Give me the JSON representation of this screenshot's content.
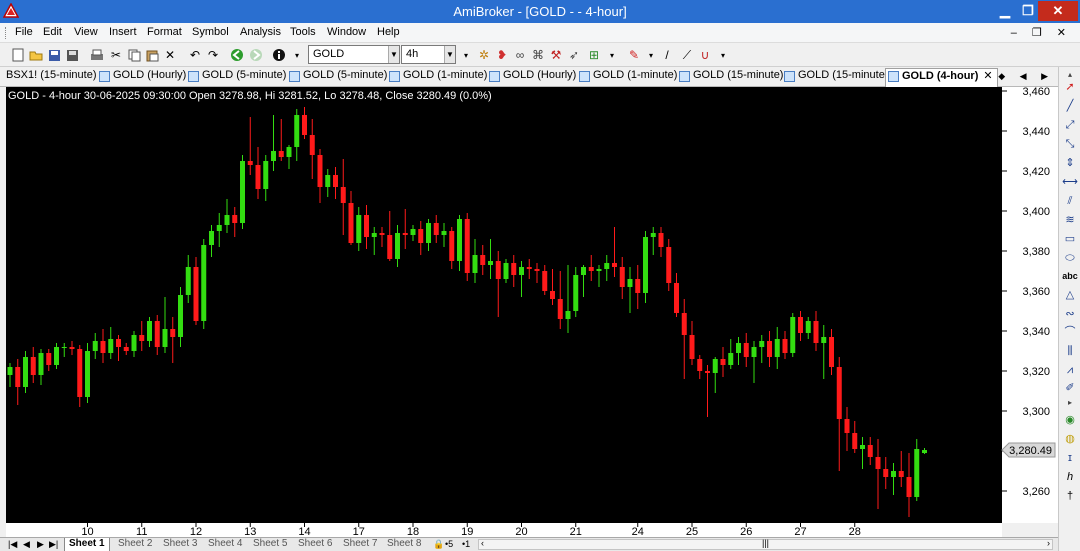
{
  "window": {
    "title": "AmiBroker - [GOLD -  - 4-hour]",
    "minimize": "▁",
    "maximize": "❐",
    "close": "✕"
  },
  "menu": {
    "items": [
      "File",
      "Edit",
      "View",
      "Insert",
      "Format",
      "Symbol",
      "Analysis",
      "Tools",
      "Window",
      "Help"
    ],
    "mdi_controls": "‒ ❐ ✕"
  },
  "toolbar": {
    "symbol_value": "GOLD",
    "interval_value": "4h"
  },
  "tabs": {
    "items": [
      {
        "label": "BSX1! (15-minute)",
        "active": false
      },
      {
        "label": "GOLD (Hourly)",
        "active": false
      },
      {
        "label": "GOLD (5-minute)",
        "active": false
      },
      {
        "label": "GOLD (5-minute)",
        "active": false
      },
      {
        "label": "GOLD (1-minute)",
        "active": false
      },
      {
        "label": "GOLD (Hourly)",
        "active": false
      },
      {
        "label": "GOLD (1-minute)",
        "active": false
      },
      {
        "label": "GOLD (15-minute)",
        "active": false
      },
      {
        "label": "GOLD (15-minute)",
        "active": false
      },
      {
        "label": "GOLD (4-hour)",
        "active": true
      }
    ],
    "close_glyph": "✕",
    "nav": "◆ ◀ ▶"
  },
  "chart": {
    "header": "GOLD - 4-hour 30-06-2025 09:30:00 Open 3278.98, Hi 3281.52, Lo 3278.48, Close 3280.49 (0.0%)",
    "price_label": "3,280.49",
    "colors": {
      "up": "#33dd11",
      "down": "#ff1a1a",
      "background": "#000000",
      "grid": "#222222"
    }
  },
  "chart_data": {
    "type": "candlestick",
    "symbol": "GOLD",
    "interval": "4-hour",
    "ylim": [
      3244,
      3462
    ],
    "yticks": [
      3260,
      3280,
      3300,
      3320,
      3340,
      3360,
      3380,
      3400,
      3420,
      3440,
      3460
    ],
    "ytick_labels": [
      "3,260",
      "3,280",
      "3,300",
      "3,320",
      "3,340",
      "3,360",
      "3,380",
      "3,400",
      "3,420",
      "3,440",
      "3,460"
    ],
    "x_labels": [
      {
        "label": "10",
        "index": 10
      },
      {
        "label": "11",
        "index": 17
      },
      {
        "label": "12",
        "index": 24
      },
      {
        "label": "13",
        "index": 31
      },
      {
        "label": "14",
        "index": 38
      },
      {
        "label": "17",
        "index": 45
      },
      {
        "label": "18",
        "index": 52
      },
      {
        "label": "19",
        "index": 59
      },
      {
        "label": "20",
        "index": 66
      },
      {
        "label": "21",
        "index": 73
      },
      {
        "label": "24",
        "index": 81
      },
      {
        "label": "25",
        "index": 88
      },
      {
        "label": "26",
        "index": 95
      },
      {
        "label": "27",
        "index": 102
      },
      {
        "label": "28",
        "index": 109
      }
    ],
    "candles": [
      [
        3318,
        3324,
        3312,
        3322
      ],
      [
        3322,
        3326,
        3303,
        3312
      ],
      [
        3312,
        3330,
        3309,
        3327
      ],
      [
        3327,
        3332,
        3314,
        3318
      ],
      [
        3318,
        3331,
        3313,
        3329
      ],
      [
        3329,
        3331,
        3320,
        3323
      ],
      [
        3323,
        3334,
        3321,
        3332
      ],
      [
        3332,
        3334,
        3327,
        3332
      ],
      [
        3332,
        3335,
        3328,
        3331
      ],
      [
        3331,
        3333,
        3302,
        3307
      ],
      [
        3307,
        3334,
        3304,
        3330
      ],
      [
        3330,
        3339,
        3326,
        3335
      ],
      [
        3335,
        3341,
        3324,
        3329
      ],
      [
        3329,
        3342,
        3326,
        3336
      ],
      [
        3336,
        3338,
        3325,
        3332
      ],
      [
        3332,
        3334,
        3328,
        3330
      ],
      [
        3330,
        3340,
        3327,
        3338
      ],
      [
        3338,
        3345,
        3330,
        3335
      ],
      [
        3335,
        3347,
        3332,
        3345
      ],
      [
        3345,
        3348,
        3328,
        3332
      ],
      [
        3332,
        3357,
        3329,
        3341
      ],
      [
        3341,
        3347,
        3324,
        3337
      ],
      [
        3337,
        3362,
        3332,
        3358
      ],
      [
        3358,
        3378,
        3354,
        3372
      ],
      [
        3372,
        3377,
        3343,
        3345
      ],
      [
        3345,
        3386,
        3341,
        3383
      ],
      [
        3383,
        3393,
        3377,
        3390
      ],
      [
        3390,
        3399,
        3382,
        3393
      ],
      [
        3393,
        3406,
        3389,
        3398
      ],
      [
        3398,
        3402,
        3387,
        3394
      ],
      [
        3394,
        3428,
        3391,
        3425
      ],
      [
        3425,
        3447,
        3418,
        3423
      ],
      [
        3423,
        3432,
        3406,
        3411
      ],
      [
        3411,
        3428,
        3405,
        3425
      ],
      [
        3425,
        3448,
        3420,
        3430
      ],
      [
        3430,
        3446,
        3425,
        3427
      ],
      [
        3427,
        3433,
        3421,
        3432
      ],
      [
        3432,
        3451,
        3425,
        3448
      ],
      [
        3448,
        3452,
        3436,
        3438
      ],
      [
        3438,
        3446,
        3416,
        3428
      ],
      [
        3428,
        3431,
        3404,
        3412
      ],
      [
        3412,
        3421,
        3407,
        3418
      ],
      [
        3418,
        3422,
        3406,
        3412
      ],
      [
        3412,
        3426,
        3388,
        3404
      ],
      [
        3404,
        3410,
        3383,
        3384
      ],
      [
        3384,
        3402,
        3380,
        3398
      ],
      [
        3398,
        3403,
        3381,
        3387
      ],
      [
        3387,
        3392,
        3378,
        3389
      ],
      [
        3389,
        3392,
        3382,
        3388
      ],
      [
        3388,
        3400,
        3375,
        3376
      ],
      [
        3376,
        3393,
        3372,
        3389
      ],
      [
        3389,
        3401,
        3381,
        3388
      ],
      [
        3388,
        3393,
        3385,
        3391
      ],
      [
        3391,
        3395,
        3378,
        3384
      ],
      [
        3384,
        3396,
        3380,
        3394
      ],
      [
        3394,
        3398,
        3384,
        3388
      ],
      [
        3388,
        3394,
        3382,
        3390
      ],
      [
        3390,
        3392,
        3371,
        3375
      ],
      [
        3375,
        3398,
        3370,
        3396
      ],
      [
        3396,
        3399,
        3365,
        3369
      ],
      [
        3369,
        3386,
        3364,
        3378
      ],
      [
        3378,
        3383,
        3368,
        3373
      ],
      [
        3373,
        3386,
        3366,
        3375
      ],
      [
        3375,
        3380,
        3347,
        3366
      ],
      [
        3366,
        3376,
        3364,
        3374
      ],
      [
        3374,
        3378,
        3362,
        3368
      ],
      [
        3368,
        3375,
        3357,
        3372
      ],
      [
        3372,
        3376,
        3366,
        3371
      ],
      [
        3371,
        3374,
        3364,
        3370
      ],
      [
        3370,
        3373,
        3358,
        3360
      ],
      [
        3360,
        3371,
        3353,
        3356
      ],
      [
        3356,
        3370,
        3341,
        3346
      ],
      [
        3346,
        3373,
        3339,
        3350
      ],
      [
        3350,
        3372,
        3347,
        3368
      ],
      [
        3368,
        3373,
        3357,
        3372
      ],
      [
        3372,
        3378,
        3365,
        3370
      ],
      [
        3370,
        3373,
        3362,
        3371
      ],
      [
        3371,
        3378,
        3365,
        3374
      ],
      [
        3374,
        3392,
        3367,
        3372
      ],
      [
        3372,
        3377,
        3356,
        3362
      ],
      [
        3362,
        3372,
        3349,
        3366
      ],
      [
        3366,
        3373,
        3351,
        3359
      ],
      [
        3359,
        3390,
        3354,
        3387
      ],
      [
        3387,
        3392,
        3378,
        3389
      ],
      [
        3389,
        3392,
        3377,
        3382
      ],
      [
        3382,
        3386,
        3360,
        3364
      ],
      [
        3364,
        3369,
        3347,
        3349
      ],
      [
        3349,
        3356,
        3316,
        3338
      ],
      [
        3338,
        3345,
        3323,
        3326
      ],
      [
        3326,
        3328,
        3316,
        3320
      ],
      [
        3320,
        3323,
        3297,
        3319
      ],
      [
        3319,
        3327,
        3309,
        3326
      ],
      [
        3326,
        3332,
        3317,
        3323
      ],
      [
        3323,
        3336,
        3321,
        3329
      ],
      [
        3329,
        3337,
        3323,
        3334
      ],
      [
        3334,
        3339,
        3322,
        3327
      ],
      [
        3327,
        3335,
        3314,
        3332
      ],
      [
        3332,
        3338,
        3324,
        3335
      ],
      [
        3335,
        3340,
        3322,
        3327
      ],
      [
        3327,
        3342,
        3321,
        3336
      ],
      [
        3336,
        3340,
        3326,
        3329
      ],
      [
        3329,
        3349,
        3327,
        3347
      ],
      [
        3347,
        3350,
        3335,
        3339
      ],
      [
        3339,
        3347,
        3336,
        3345
      ],
      [
        3345,
        3350,
        3330,
        3334
      ],
      [
        3334,
        3343,
        3316,
        3337
      ],
      [
        3337,
        3341,
        3318,
        3322
      ],
      [
        3322,
        3327,
        3270,
        3296
      ],
      [
        3296,
        3302,
        3280,
        3289
      ],
      [
        3289,
        3295,
        3279,
        3281
      ],
      [
        3281,
        3287,
        3271,
        3283
      ],
      [
        3283,
        3287,
        3273,
        3277
      ],
      [
        3277,
        3286,
        3251,
        3271
      ],
      [
        3271,
        3277,
        3261,
        3267
      ],
      [
        3267,
        3274,
        3258,
        3270
      ],
      [
        3270,
        3280,
        3262,
        3267
      ],
      [
        3267,
        3279,
        3247,
        3257
      ],
      [
        3257,
        3286,
        3255,
        3281
      ],
      [
        3278.98,
        3281.52,
        3278.48,
        3280.49
      ]
    ]
  }
}
